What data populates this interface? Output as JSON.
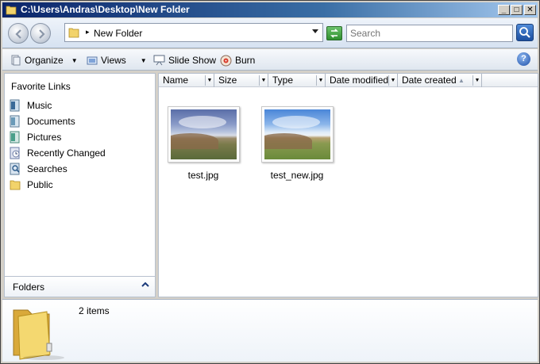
{
  "window": {
    "title": "C:\\Users\\Andras\\Desktop\\New Folder",
    "controls": {
      "minimize": "_",
      "maximize": "□",
      "close": "✕"
    }
  },
  "address": {
    "path": "New Folder",
    "search_placeholder": "Search"
  },
  "toolbar": {
    "organize": "Organize",
    "views": "Views",
    "slideshow": "Slide Show",
    "burn": "Burn",
    "help": "?"
  },
  "nav": {
    "header": "Favorite Links",
    "items": [
      {
        "label": "Music",
        "icon": "music-folder-icon"
      },
      {
        "label": "Documents",
        "icon": "documents-folder-icon"
      },
      {
        "label": "Pictures",
        "icon": "pictures-folder-icon"
      },
      {
        "label": "Recently Changed",
        "icon": "recent-folder-icon"
      },
      {
        "label": "Searches",
        "icon": "searches-folder-icon"
      },
      {
        "label": "Public",
        "icon": "public-folder-icon"
      }
    ],
    "folders_label": "Folders"
  },
  "columns": [
    "Name",
    "Size",
    "Type",
    "Date modified",
    "Date created"
  ],
  "files": [
    {
      "name": "test.jpg"
    },
    {
      "name": "test_new.jpg"
    }
  ],
  "details": {
    "count": "2 items"
  },
  "colors": {
    "title_bar": "#0a246a",
    "pane_border": "#b7c1cf",
    "folder": "#e8c44a"
  }
}
